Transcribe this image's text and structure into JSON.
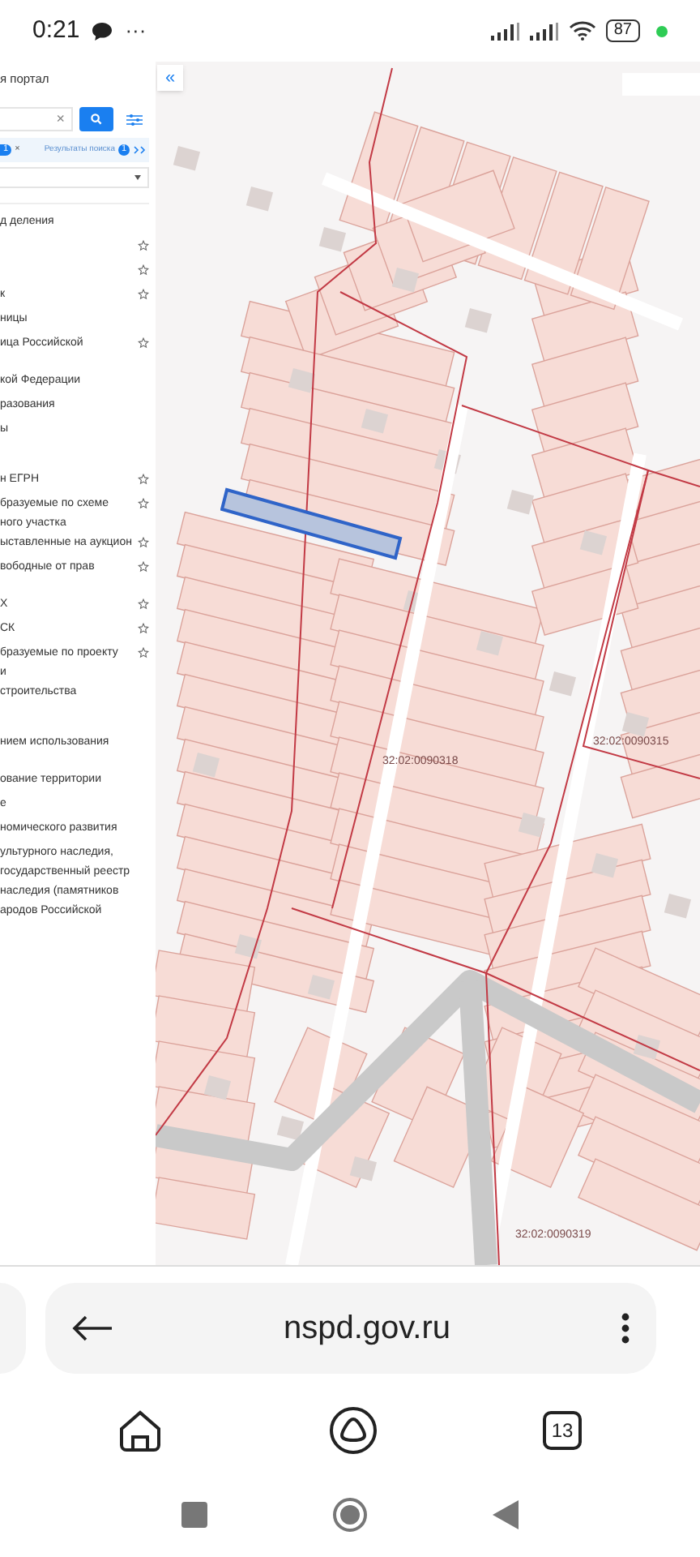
{
  "status_bar": {
    "time": "0:21",
    "more": "···",
    "battery": "87"
  },
  "sidebar": {
    "title": "я портал",
    "clear": "×",
    "chip": {
      "count": "1",
      "close": "×"
    },
    "results_tab": {
      "label": "Результаты поиска",
      "count": "1"
    },
    "layers": [
      {
        "lines": [
          "д деления"
        ],
        "kind": "plain"
      },
      {
        "kind": "favorite"
      },
      {
        "kind": "favorite"
      },
      {
        "lines": [
          "к"
        ],
        "kind": "favorite"
      },
      {
        "lines": [
          "ницы"
        ],
        "kind": "plain"
      },
      {
        "lines": [
          "ица Российской"
        ],
        "kind": "favorite"
      },
      {
        "lines": [
          "кой Федерации"
        ],
        "kind": "plain"
      },
      {
        "lines": [
          "разования"
        ],
        "kind": "plain"
      },
      {
        "lines": [
          "ы"
        ],
        "kind": "plain"
      },
      {
        "lines": [
          "н ЕГРН"
        ],
        "kind": "favorite"
      },
      {
        "lines": [
          "бразуемые по схеме",
          "ного участка"
        ],
        "kind": "favorite"
      },
      {
        "lines": [
          "ыставленные на аукцион"
        ],
        "kind": "favorite"
      },
      {
        "lines": [
          "вободные от прав"
        ],
        "kind": "favorite"
      },
      {
        "lines": [
          "Х"
        ],
        "kind": "favorite"
      },
      {
        "lines": [
          "СК"
        ],
        "kind": "favorite"
      },
      {
        "lines": [
          "бразуемые по проекту",
          "и"
        ],
        "kind": "favorite"
      },
      {
        "lines": [
          "строительства"
        ],
        "kind": "plain"
      },
      {
        "lines": [
          "нием использования"
        ],
        "kind": "plain"
      },
      {
        "lines": [
          "ование территории"
        ],
        "kind": "plain"
      },
      {
        "lines": [
          "е"
        ],
        "kind": "plain"
      },
      {
        "lines": [
          "номического развития"
        ],
        "kind": "plain"
      },
      {
        "lines": [
          "ультурного наследия,",
          "государственный реестр",
          "наследия (памятников",
          "ародов Российской"
        ],
        "kind": "plain"
      }
    ]
  },
  "map": {
    "collapse": "«",
    "labels": [
      "32:02:0090318",
      "32:02:0090315",
      "32:02:0090319"
    ]
  },
  "browser": {
    "url": "nspd.gov.ru",
    "tab_count": "13"
  }
}
